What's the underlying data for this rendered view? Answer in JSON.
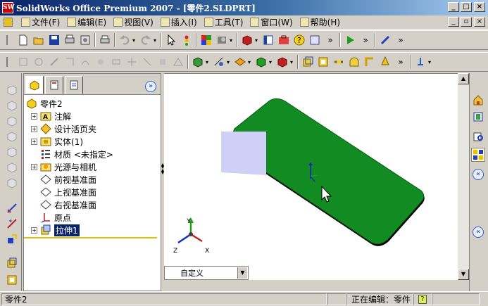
{
  "title": "SolidWorks Office Premium 2007 - [零件2.SLDPRT]",
  "title_icon": "SW",
  "menus": [
    {
      "label": "文件(F)"
    },
    {
      "label": "编辑(E)"
    },
    {
      "label": "视图(V)"
    },
    {
      "label": "插入(I)"
    },
    {
      "label": "工具(T)"
    },
    {
      "label": "窗口(W)"
    },
    {
      "label": "帮助(H)"
    }
  ],
  "tree": {
    "root": "零件2",
    "items": [
      {
        "label": "注解",
        "icon": "annotation-icon",
        "expander": "+"
      },
      {
        "label": "设计活页夹",
        "icon": "design-binder-icon",
        "expander": "+"
      },
      {
        "label": "实体(1)",
        "icon": "solid-bodies-icon",
        "expander": "+"
      },
      {
        "label": "材质 <未指定>",
        "icon": "material-icon",
        "expander": ""
      },
      {
        "label": "光源与相机",
        "icon": "lights-cameras-icon",
        "expander": "+"
      },
      {
        "label": "前视基准面",
        "icon": "plane-icon",
        "expander": ""
      },
      {
        "label": "上视基准面",
        "icon": "plane-icon",
        "expander": ""
      },
      {
        "label": "右视基准面",
        "icon": "plane-icon",
        "expander": ""
      },
      {
        "label": "原点",
        "icon": "origin-icon",
        "expander": ""
      },
      {
        "label": "拉伸1",
        "icon": "extrude-icon",
        "expander": "+",
        "selected": true
      }
    ]
  },
  "view_dropdown": "自定义",
  "status": {
    "left": "零件2",
    "editing": "正在编辑：零件",
    "help": "?"
  },
  "triad": {
    "x": "X",
    "y": "Y",
    "z": "Z"
  },
  "colors": {
    "model_green": "#118b22",
    "sketch_face": "#cfd0f5",
    "title_dark": "#0a246a"
  }
}
